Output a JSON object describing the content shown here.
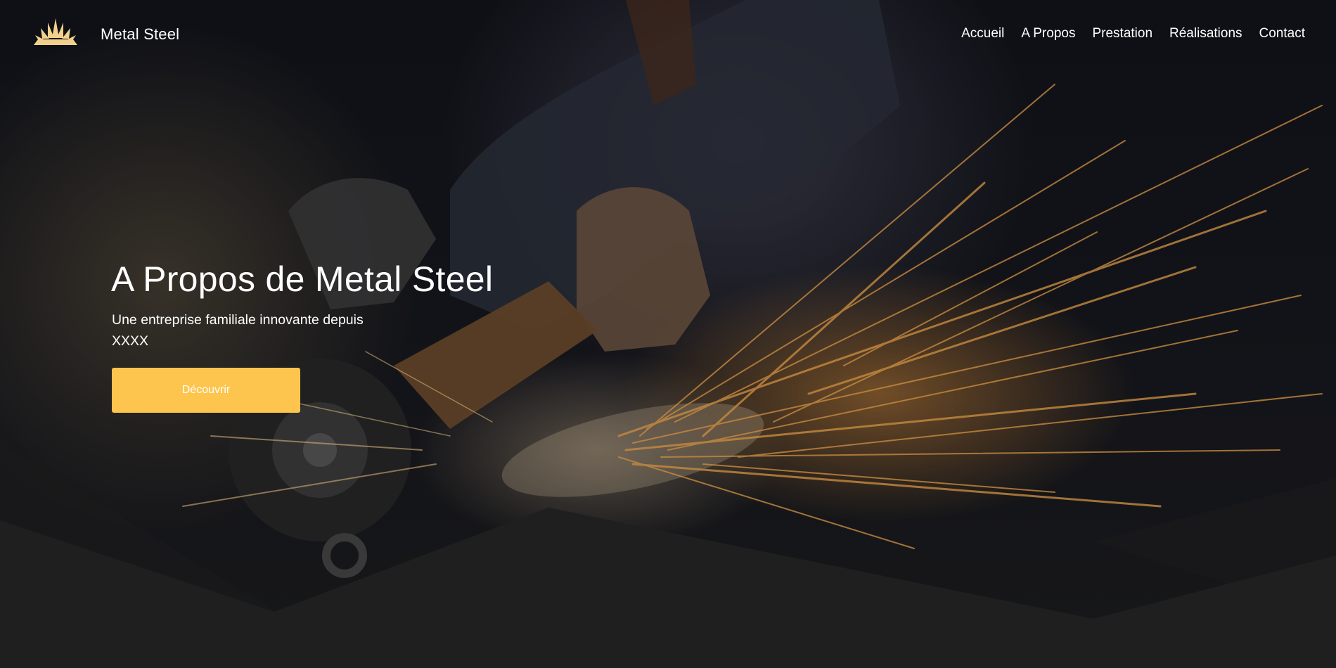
{
  "header": {
    "brand": "Metal Steel",
    "logo_icon": "crown-flame-logo-icon",
    "nav": [
      {
        "label": "Accueil"
      },
      {
        "label": "A Propos"
      },
      {
        "label": "Prestation"
      },
      {
        "label": "Réalisations"
      },
      {
        "label": "Contact"
      }
    ]
  },
  "hero": {
    "title": "A Propos de Metal Steel",
    "subtitle": "Une entreprise familiale innovante depuis XXXX",
    "cta_label": "Découvrir",
    "background": "welder-grinding-sparks-photo"
  },
  "colors": {
    "accent": "#fdc54d",
    "text": "#ffffff",
    "base_dark": "#1f1f1f",
    "logo_gold": "#f1d08c",
    "spark": "#f0a64a"
  }
}
